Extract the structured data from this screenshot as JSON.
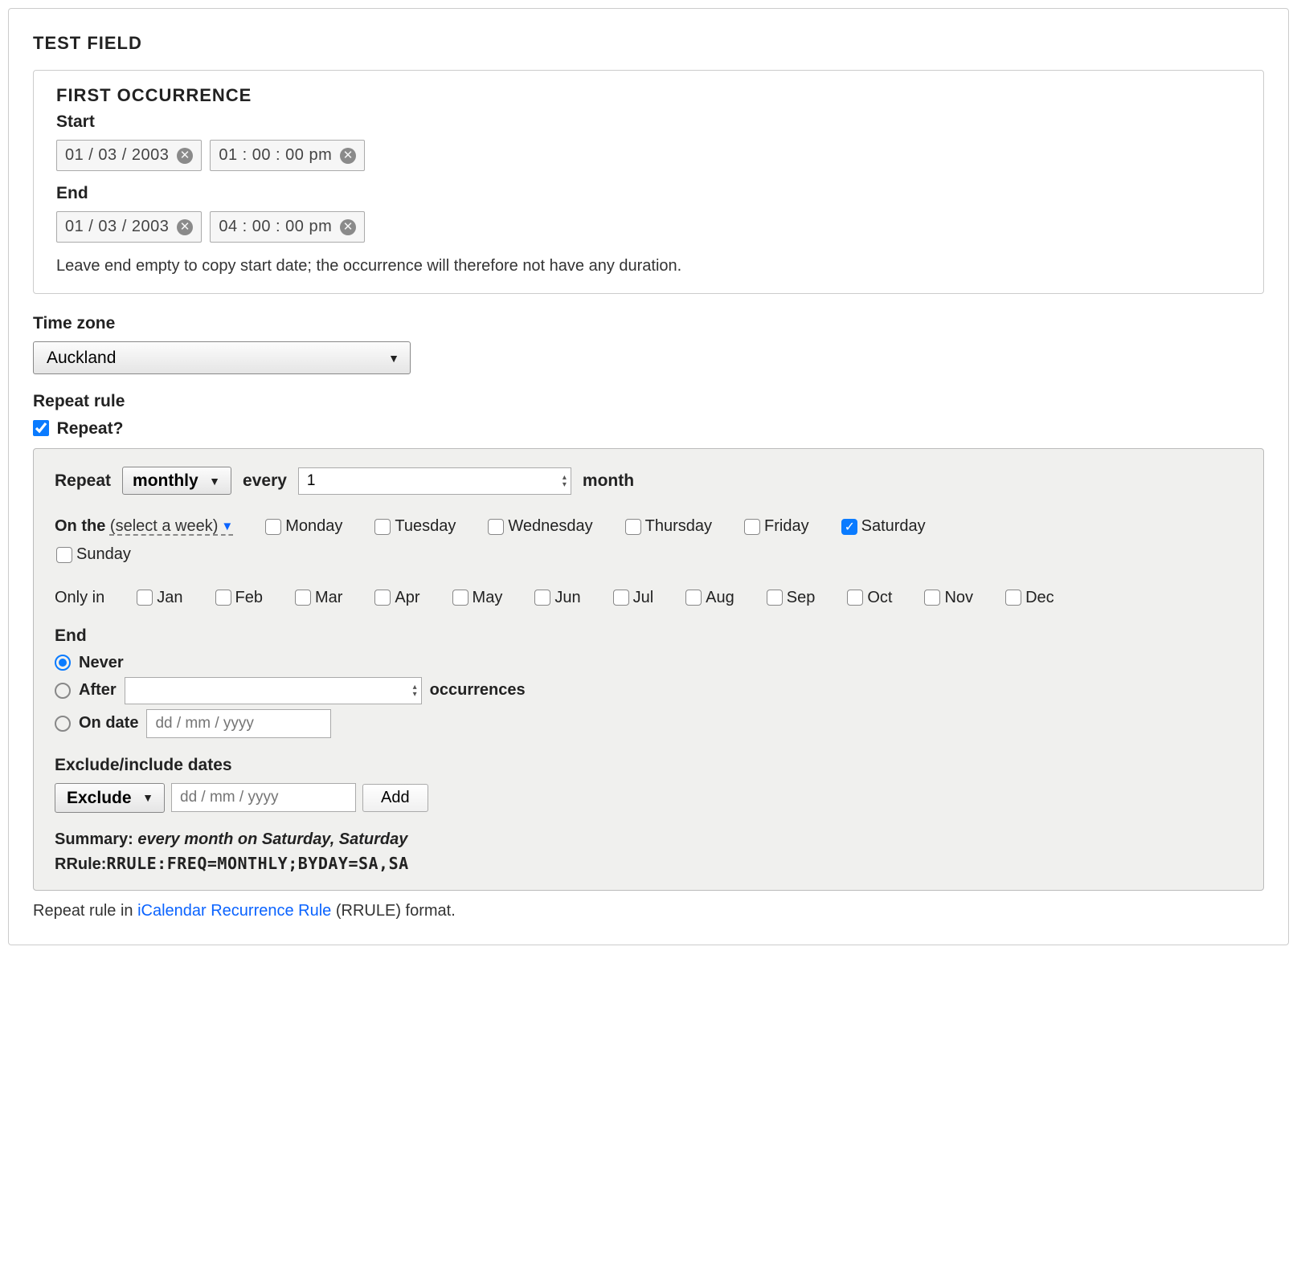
{
  "panel_title": "TEST FIELD",
  "occurrence": {
    "title": "FIRST OCCURRENCE",
    "start_label": "Start",
    "start_date": "01 / 03 / 2003",
    "start_time": "01 : 00 : 00   pm",
    "end_label": "End",
    "end_date": "01 / 03 / 2003",
    "end_time": "04 : 00 : 00   pm",
    "helper": "Leave end empty to copy start date; the occurrence will therefore not have any duration."
  },
  "timezone": {
    "label": "Time zone",
    "value": "Auckland"
  },
  "repeat": {
    "label": "Repeat rule",
    "checkbox_label": "Repeat?",
    "checked": true,
    "repeat_word": "Repeat",
    "freq": "monthly",
    "every_word": "every",
    "interval": "1",
    "unit": "month",
    "on_the": "On the",
    "select_week": "(select a week)",
    "weekdays": [
      "Monday",
      "Tuesday",
      "Wednesday",
      "Thursday",
      "Friday",
      "Saturday",
      "Sunday"
    ],
    "weekday_checked": "Saturday",
    "only_in": "Only in",
    "months": [
      "Jan",
      "Feb",
      "Mar",
      "Apr",
      "May",
      "Jun",
      "Jul",
      "Aug",
      "Sep",
      "Oct",
      "Nov",
      "Dec"
    ],
    "end": {
      "label": "End",
      "never": "Never",
      "after": "After",
      "occurrences_word": "occurrences",
      "on_date": "On date",
      "date_placeholder": "dd / mm / yyyy",
      "selected": "never"
    },
    "exclude": {
      "label": "Exclude/include dates",
      "mode": "Exclude",
      "date_placeholder": "dd / mm / yyyy",
      "add": "Add"
    },
    "summary_label": "Summary:",
    "summary_text": "every month on Saturday, Saturday",
    "rrule_label": "RRule:",
    "rrule_value": "RRULE:FREQ=MONTHLY;BYDAY=SA,SA"
  },
  "footer": {
    "prefix": "Repeat rule in ",
    "link": "iCalendar Recurrence Rule",
    "suffix": " (RRULE) format."
  }
}
